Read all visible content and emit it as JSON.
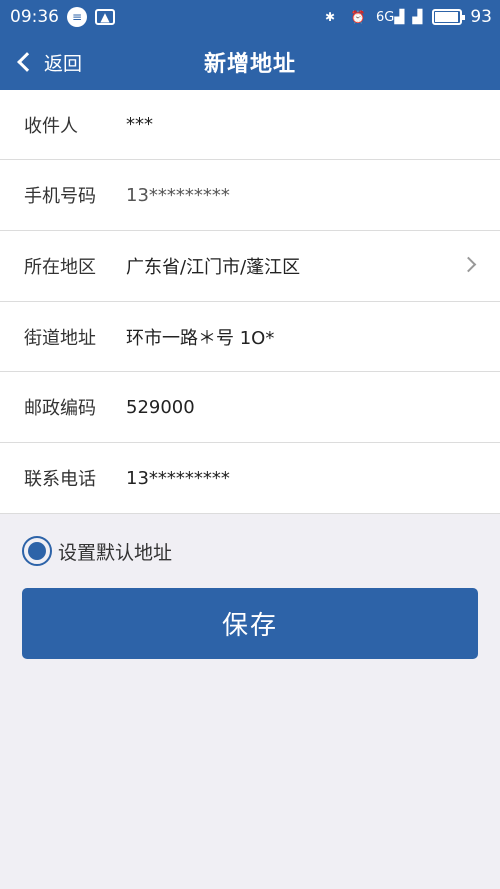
{
  "status_bar": {
    "time": "09:36",
    "network_label": "6G",
    "battery_level": "93",
    "battery_fraction": 0.93
  },
  "nav": {
    "back_label": "返回",
    "title": "新增地址"
  },
  "form": {
    "rows": [
      {
        "label": "收件人",
        "value": "***"
      },
      {
        "label": "手机号码",
        "value": "13*********"
      },
      {
        "label": "所在地区",
        "value": "广东省/江门市/蓬江区"
      },
      {
        "label": "街道地址",
        "value": "环市一路＊号 1O*"
      },
      {
        "label": "邮政编码",
        "value": "529000"
      },
      {
        "label": "联系电话",
        "value": "13*********"
      }
    ]
  },
  "default_address": {
    "label": "设置默认地址",
    "checked": true
  },
  "save_label": "保存",
  "colors": {
    "primary": "#2d63a8",
    "background": "#f0eff4"
  },
  "icons": {
    "chat": "chat-bubble-icon",
    "mail": "image-message-icon",
    "bluetooth": "bluetooth-icon",
    "alarm": "alarm-clock-icon",
    "signal": "signal-icon",
    "battery": "battery-icon",
    "back": "chevron-left-icon",
    "region_arrow": "chevron-right-icon"
  }
}
